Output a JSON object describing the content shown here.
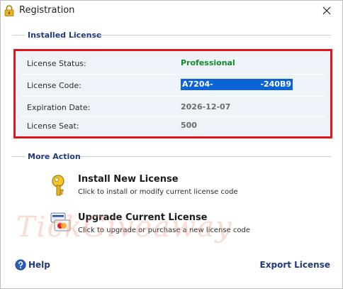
{
  "window": {
    "title": "Registration",
    "close_glyph": "✕"
  },
  "installed_license": {
    "header": "Installed License",
    "rows": [
      {
        "label": "License Status:",
        "value": "Professional",
        "value_color": "#138a2a"
      },
      {
        "label": "License Code:",
        "value_left": "A7204-",
        "value_right": "-240B9",
        "highlighted": true
      },
      {
        "label": "Expiration Date:",
        "value": "2026-12-07"
      },
      {
        "label": "License Seat:",
        "value": "500"
      }
    ]
  },
  "more_action": {
    "header": "More Action",
    "actions": [
      {
        "icon": "key-icon",
        "title": "Install New License",
        "description": "Click to install or modify current license code"
      },
      {
        "icon": "credit-card-icon",
        "title": "Upgrade Current License",
        "description": "Click to upgrade or purchase a new license code"
      }
    ]
  },
  "watermark": "TickGiveaway",
  "footer": {
    "help_label": "Help",
    "export_label": "Export License"
  },
  "colors": {
    "accent": "#1e3a78",
    "highlight_border": "#e0161a",
    "selection": "#0a64d8",
    "status_green": "#138a2a"
  }
}
